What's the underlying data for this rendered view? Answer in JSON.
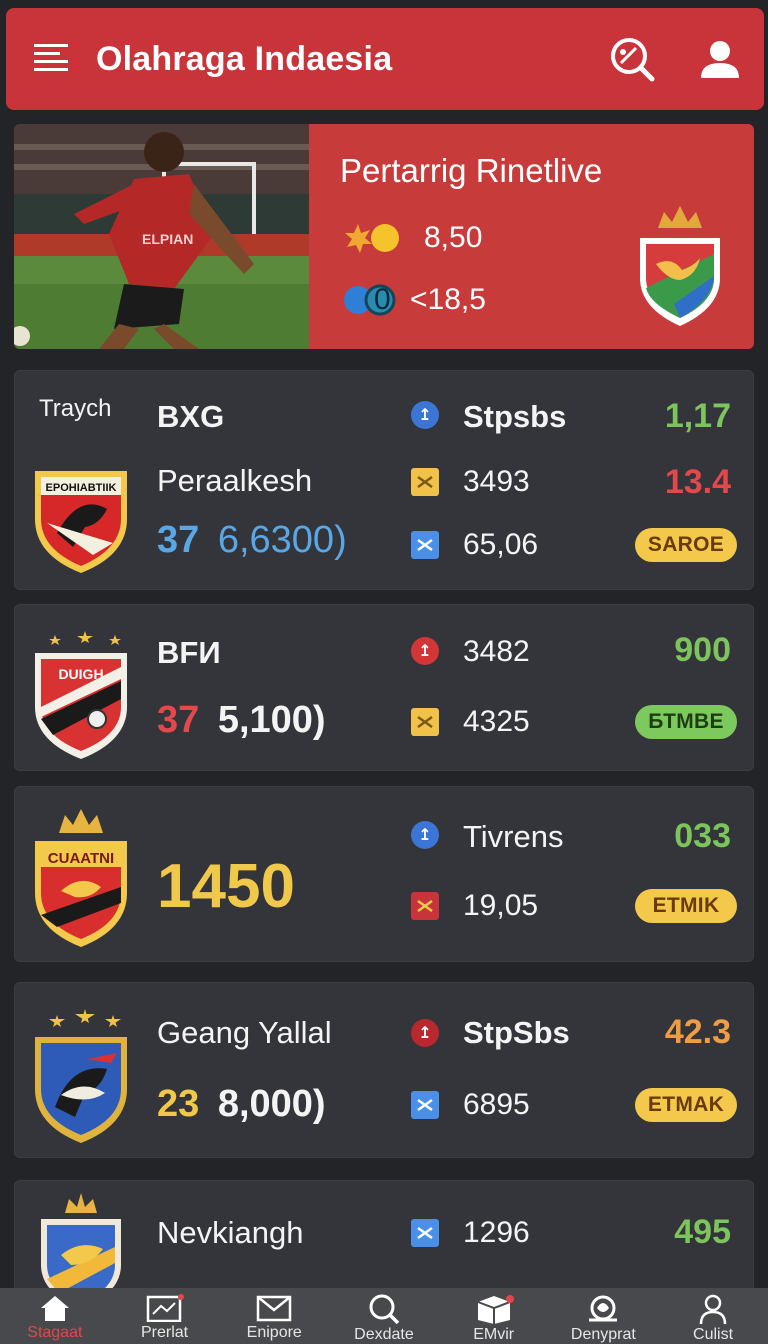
{
  "header": {
    "title": "Olahraga Indaesia",
    "bg_color": "#c8343a"
  },
  "hero": {
    "headline": "Pertarrig Rinetlive",
    "stat1": "8,50",
    "stat2_left": "0",
    "stat2": "<18,5",
    "bg_color": "#c73b3b"
  },
  "cards": [
    {
      "label": "Traych",
      "team": "BXG",
      "player": "Peraalkesh",
      "score_left": "37",
      "score_right": "6,6300)",
      "crest_text": "EPOHIABTIIK",
      "stat_rows": [
        "Stpsbs",
        "3493",
        "65,06"
      ],
      "right_value": "1,17",
      "right_value_2": "13.4",
      "badge": "SAROE"
    },
    {
      "team": "BFИ",
      "crest_text": "DUIGH",
      "score_left": "37",
      "score_right": "5,100)",
      "stat_rows": [
        "3482",
        "4325"
      ],
      "right_value": "900",
      "badge": "БТМBE"
    },
    {
      "crest_text": "CUAATNI",
      "big_number": "1450",
      "stat_rows": [
        "Tivrens",
        "19,05"
      ],
      "right_value": "033",
      "badge": "ETMIK"
    },
    {
      "player": "Geang Yallal",
      "score_left": "23",
      "score_right": "8,000)",
      "stat_rows": [
        "StpSbs",
        "6895"
      ],
      "right_value": "42.3",
      "badge": "ETMAK"
    },
    {
      "player": "Nevkiangh",
      "stat_rows": [
        "1296"
      ],
      "right_value": "495"
    }
  ],
  "bottom_nav": [
    {
      "label": "Stagaat",
      "icon": "home-icon",
      "active": true
    },
    {
      "label": "Prerlat",
      "icon": "news-icon"
    },
    {
      "label": "Enipore",
      "icon": "mail-icon"
    },
    {
      "label": "Dexdate",
      "icon": "search-icon"
    },
    {
      "label": "EMvir",
      "icon": "box-icon"
    },
    {
      "label": "Denyprat",
      "icon": "trophy-icon"
    },
    {
      "label": "Culist",
      "icon": "user-icon"
    }
  ],
  "colors": {
    "background": "#232427",
    "card": "#34353a",
    "green": "#7cc45b",
    "red": "#e3484a",
    "blue": "#5aa7e6",
    "yellow": "#f0c94a",
    "orange": "#ee9d45"
  }
}
